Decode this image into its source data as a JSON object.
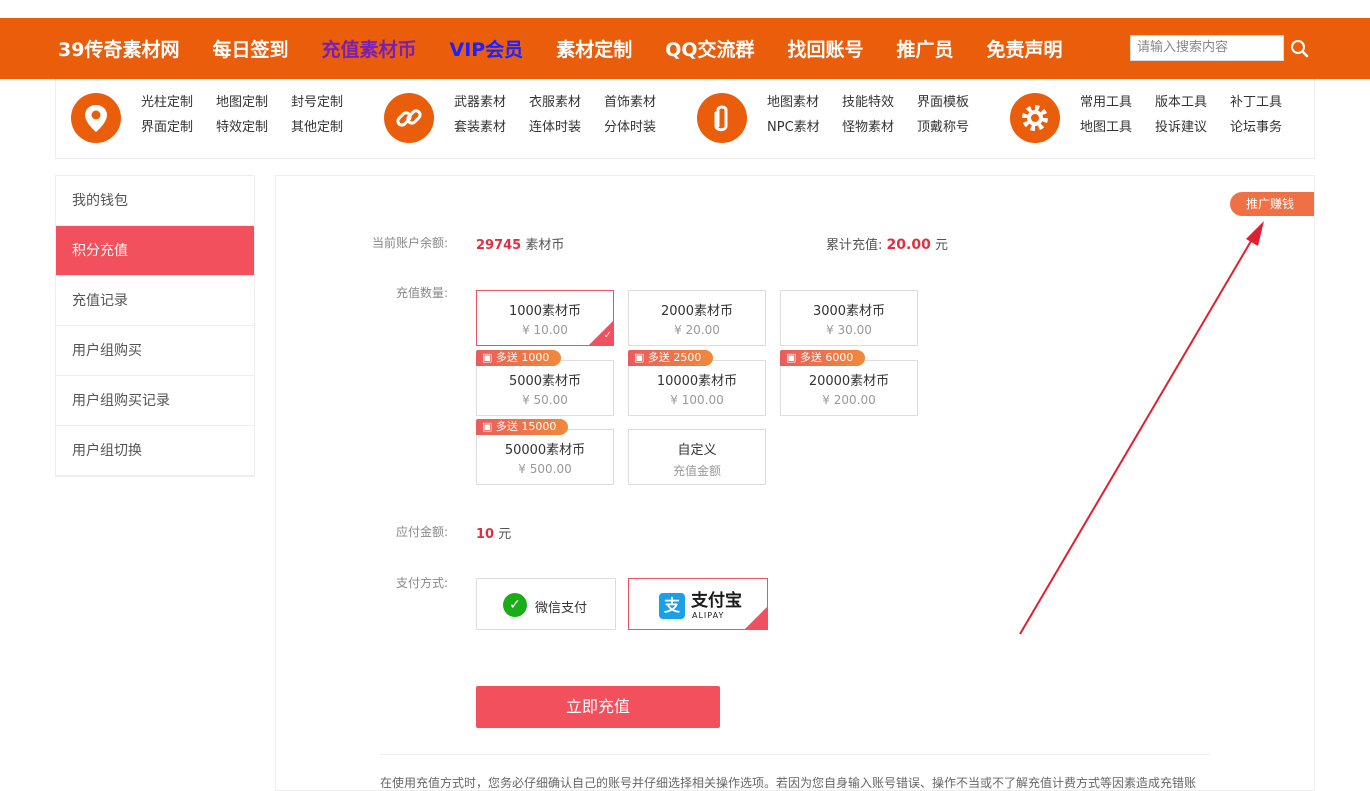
{
  "topnav": {
    "items": [
      "39传奇素材网",
      "每日签到",
      "充值素材币",
      "VIP会员",
      "素材定制",
      "QQ交流群",
      "找回账号",
      "推广员",
      "免责声明"
    ],
    "search_placeholder": "请输入搜索内容"
  },
  "categories": [
    {
      "icon": "location-pin-icon",
      "links": [
        "光柱定制",
        "地图定制",
        "封号定制",
        "界面定制",
        "特效定制",
        "其他定制"
      ]
    },
    {
      "icon": "link-icon",
      "links": [
        "武器素材",
        "衣服素材",
        "首饰素材",
        "套装素材",
        "连体时装",
        "分体时装"
      ]
    },
    {
      "icon": "paperclip-icon",
      "links": [
        "地图素材",
        "技能特效",
        "界面模板",
        "NPC素材",
        "怪物素材",
        "顶戴称号"
      ]
    },
    {
      "icon": "gear-icon",
      "links": [
        "常用工具",
        "版本工具",
        "补丁工具",
        "地图工具",
        "投诉建议",
        "论坛事务"
      ]
    }
  ],
  "sidebar": {
    "items": [
      "我的钱包",
      "积分充值",
      "充值记录",
      "用户组购买",
      "用户组购买记录",
      "用户组切换"
    ],
    "active_index": 1
  },
  "main": {
    "promo_label": "推广赚钱",
    "balance_label": "当前账户余额:",
    "balance_value": "29745",
    "balance_unit": "素材币",
    "total_label": "累计充值:",
    "total_value": "20.00",
    "total_unit": "元",
    "amount_label": "充值数量:",
    "options": [
      {
        "title": "1000素材币",
        "price": "¥ 10.00",
        "bonus": "",
        "selected": true
      },
      {
        "title": "2000素材币",
        "price": "¥ 20.00",
        "bonus": "",
        "selected": false
      },
      {
        "title": "3000素材币",
        "price": "¥ 30.00",
        "bonus": "",
        "selected": false
      },
      {
        "title": "5000素材币",
        "price": "¥ 50.00",
        "bonus": "多送 1000",
        "selected": false
      },
      {
        "title": "10000素材币",
        "price": "¥ 100.00",
        "bonus": "多送 2500",
        "selected": false
      },
      {
        "title": "20000素材币",
        "price": "¥ 200.00",
        "bonus": "多送 6000",
        "selected": false
      },
      {
        "title": "50000素材币",
        "price": "¥ 500.00",
        "bonus": "多送 15000",
        "selected": false
      },
      {
        "title": "自定义",
        "price": "充值金额",
        "bonus": "",
        "selected": false
      }
    ],
    "payable_label": "应付金额:",
    "payable_value": "10",
    "payable_unit": "元",
    "pay_method_label": "支付方式:",
    "pay_wechat": "微信支付",
    "pay_alipay": "支付宝",
    "pay_alipay_sub": "ALIPAY",
    "submit_label": "立即充值",
    "notice": "在使用充值方式时，您务必仔细确认自己的账号并仔细选择相关操作选项。若因为您自身输入账号错误、操作不当或不了解充值计费方式等因素造成充错账"
  },
  "colors": {
    "brand_orange": "#ea5d0b",
    "accent_red": "#f2505c",
    "arrow_red": "#e02030"
  }
}
